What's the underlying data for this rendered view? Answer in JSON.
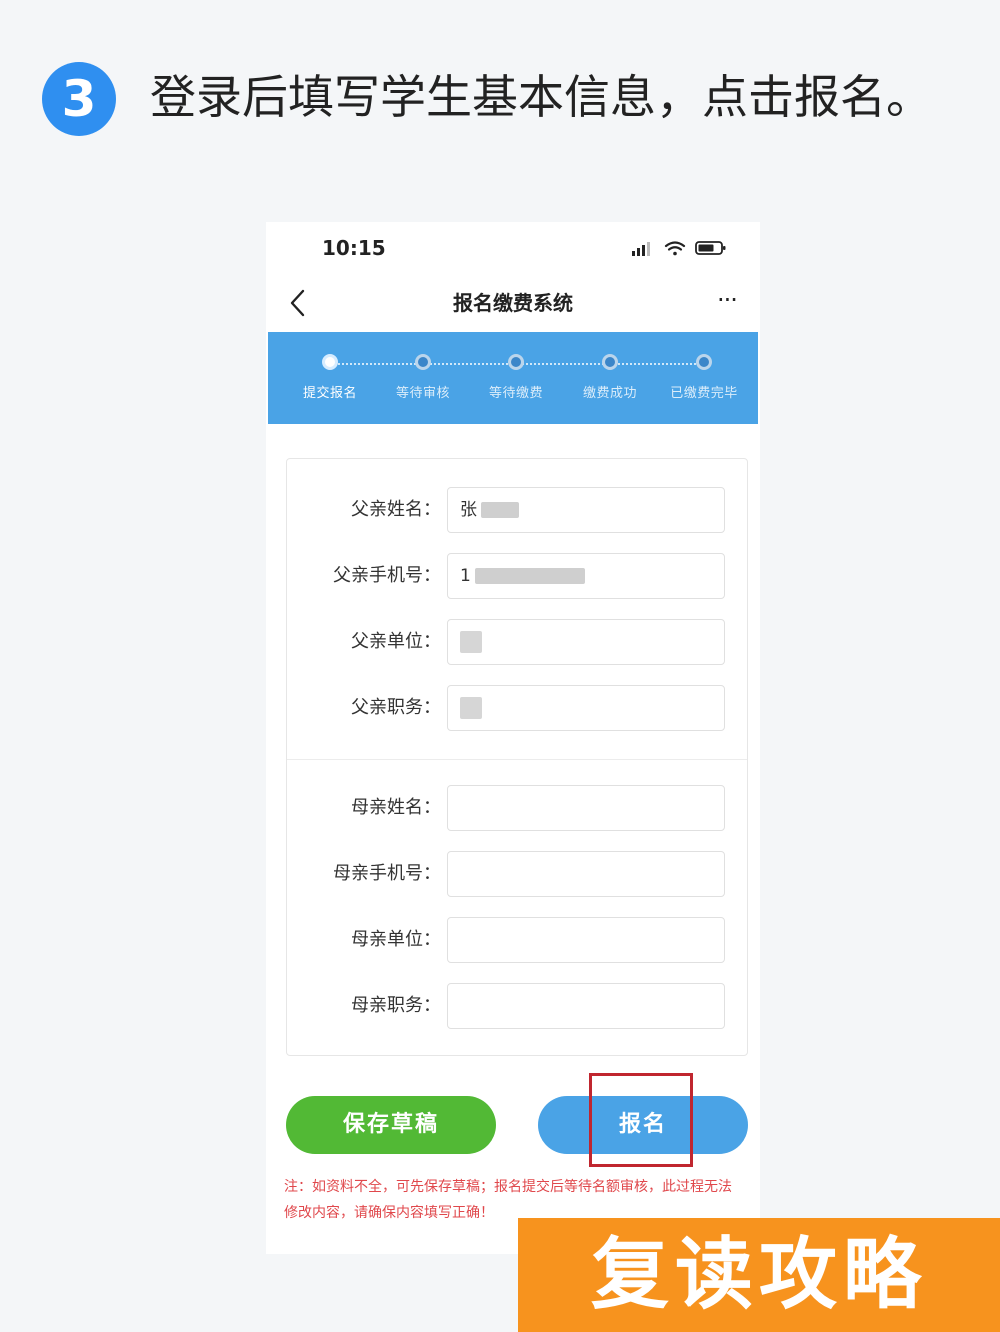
{
  "header": {
    "step_number": "3",
    "title": "登录后填写学生基本信息，点击报名。"
  },
  "phone": {
    "status_bar": {
      "time": "10:15"
    },
    "nav": {
      "title": "报名缴费系统",
      "more": "···"
    },
    "progress": {
      "steps": [
        {
          "label": "提交报名",
          "active": true
        },
        {
          "label": "等待审核",
          "active": false
        },
        {
          "label": "等待缴费",
          "active": false
        },
        {
          "label": "缴费成功",
          "active": false
        },
        {
          "label": "已缴费完毕",
          "active": false
        }
      ]
    },
    "form": {
      "father": [
        {
          "label": "父亲姓名：",
          "value": "张"
        },
        {
          "label": "父亲手机号：",
          "value": "1"
        },
        {
          "label": "父亲单位：",
          "value": ""
        },
        {
          "label": "父亲职务：",
          "value": ""
        }
      ],
      "mother": [
        {
          "label": "母亲姓名：",
          "value": ""
        },
        {
          "label": "母亲手机号：",
          "value": ""
        },
        {
          "label": "母亲单位：",
          "value": ""
        },
        {
          "label": "母亲职务：",
          "value": ""
        }
      ]
    },
    "buttons": {
      "save": "保存草稿",
      "signup": "报名"
    },
    "note": "注：如资料不全，可先保存草稿；报名提交后等待名额审核，此过程无法修改内容，请确保内容填写正确！"
  },
  "watermark": "复读攻略",
  "colors": {
    "accent_blue": "#4aa3e6",
    "badge_blue": "#2f8ff0",
    "save_green": "#52b935",
    "highlight_red": "#c0262f",
    "note_red": "#e0484c",
    "watermark_orange": "#f7931e"
  }
}
